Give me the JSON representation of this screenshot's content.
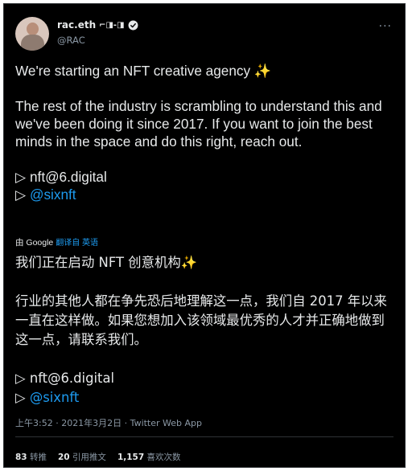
{
  "author": {
    "name": "rac.eth",
    "name_suffix": "⌐◨-◨",
    "handle": "@RAC"
  },
  "menu": {
    "more_label": "···"
  },
  "tweet": {
    "line1": "We're starting an NFT creative agency ",
    "sparkles": "✨",
    "paragraph2": "The rest of the industry is scrambling to understand this and we've been doing it since 2017. If you want to join the best minds in the space and do this right, reach out.",
    "contact_email": "▷ nft@6.digital",
    "contact_prefix": "▷ ",
    "contact_handle": "@sixnft"
  },
  "translation": {
    "by_label": "由 Google",
    "link_label": "翻译自 英语",
    "line1": "我们正在启动 NFT 创意机构",
    "sparkles": "✨",
    "paragraph2": "行业的其他人都在争先恐后地理解这一点，我们自 2017 年以来一直在这样做。如果您想加入该领域最优秀的人才并正确地做到这一点，请联系我们。",
    "contact_email": "▷ nft@6.digital",
    "contact_prefix": "▷ ",
    "contact_handle": "@sixnft"
  },
  "meta": {
    "timestamp": "上午3:52 · 2021年3月2日 · Twitter Web App"
  },
  "stats": {
    "retweets_count": "83",
    "retweets_label": "转推",
    "quotes_count": "20",
    "quotes_label": "引用推文",
    "likes_count": "1,157",
    "likes_label": "喜欢次数"
  },
  "colors": {
    "background": "#000000",
    "text": "#e7e9ea",
    "secondary": "#8b98a5",
    "link": "#1d9bf0",
    "verified": "#ffffff"
  }
}
